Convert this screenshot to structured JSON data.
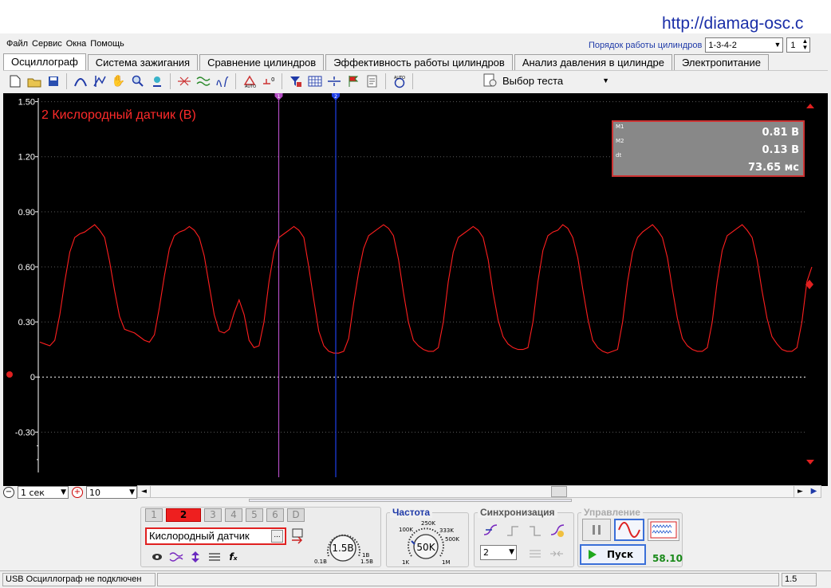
{
  "watermark": "http://diamag-osc.c",
  "menu": [
    "Файл",
    "Сервис",
    "Окна",
    "Помощь"
  ],
  "cylinder_order": {
    "label": "Порядок работы цилиндров",
    "value": "1-3-4-2",
    "number": "1"
  },
  "tabs": [
    {
      "label": "Осциллограф",
      "active": true
    },
    {
      "label": "Система зажигания",
      "active": false
    },
    {
      "label": "Сравнение цилиндров",
      "active": false
    },
    {
      "label": "Эффективность работы цилиндров",
      "active": false
    },
    {
      "label": "Анализ давления в цилиндре",
      "active": false
    },
    {
      "label": "Электропитание",
      "active": false
    }
  ],
  "toolbar": {
    "icons": [
      "new-file-icon",
      "open-folder-icon",
      "save-icon",
      "signal-shape-icon",
      "cursor-measure-icon",
      "hand-pan-icon",
      "zoom-icon",
      "filter-icon",
      "waveform-compare-icon",
      "waveform-multi-icon",
      "waveform-loop-icon",
      "auto-scale-icon",
      "zero-level-icon",
      "trigger-filter-icon",
      "grid-icon",
      "divider-icon",
      "marker-flag-icon",
      "notes-icon",
      "auto-settings-icon"
    ],
    "test_label": "Выбор теста"
  },
  "scope": {
    "channel_title": "2 Кислородный датчик (В)",
    "trace_color": "#ff1f1f",
    "y_ticks": [
      "1.50",
      "1.20",
      "0.90",
      "0.60",
      "0.30",
      "0",
      "-0.30"
    ],
    "y_tick_values": [
      1.5,
      1.2,
      0.9,
      0.6,
      0.3,
      0,
      -0.3
    ],
    "ylim": [
      -0.52,
      1.52
    ],
    "marker1_label": "1",
    "marker2_label": "2",
    "marker1_color": "#b24cc2",
    "marker2_color": "#1f3fe8",
    "waveform": [
      0.19,
      0.18,
      0.17,
      0.2,
      0.34,
      0.52,
      0.68,
      0.76,
      0.78,
      0.79,
      0.81,
      0.83,
      0.8,
      0.76,
      0.63,
      0.47,
      0.33,
      0.26,
      0.25,
      0.24,
      0.22,
      0.2,
      0.19,
      0.23,
      0.38,
      0.55,
      0.7,
      0.77,
      0.79,
      0.8,
      0.82,
      0.8,
      0.76,
      0.66,
      0.5,
      0.34,
      0.25,
      0.24,
      0.26,
      0.35,
      0.42,
      0.34,
      0.2,
      0.16,
      0.17,
      0.3,
      0.52,
      0.68,
      0.76,
      0.78,
      0.8,
      0.82,
      0.8,
      0.76,
      0.6,
      0.42,
      0.25,
      0.17,
      0.14,
      0.13,
      0.13,
      0.14,
      0.21,
      0.4,
      0.57,
      0.7,
      0.77,
      0.79,
      0.81,
      0.83,
      0.81,
      0.77,
      0.64,
      0.46,
      0.3,
      0.2,
      0.17,
      0.15,
      0.14,
      0.14,
      0.16,
      0.3,
      0.52,
      0.68,
      0.76,
      0.78,
      0.8,
      0.82,
      0.8,
      0.76,
      0.64,
      0.46,
      0.31,
      0.22,
      0.18,
      0.16,
      0.15,
      0.15,
      0.16,
      0.3,
      0.52,
      0.69,
      0.77,
      0.79,
      0.8,
      0.83,
      0.81,
      0.76,
      0.65,
      0.48,
      0.32,
      0.2,
      0.16,
      0.14,
      0.13,
      0.14,
      0.15,
      0.3,
      0.52,
      0.68,
      0.76,
      0.79,
      0.81,
      0.83,
      0.8,
      0.76,
      0.65,
      0.48,
      0.32,
      0.21,
      0.17,
      0.15,
      0.14,
      0.14,
      0.16,
      0.3,
      0.52,
      0.69,
      0.77,
      0.79,
      0.81,
      0.83,
      0.8,
      0.76,
      0.64,
      0.47,
      0.32,
      0.22,
      0.18,
      0.15,
      0.14,
      0.14,
      0.16,
      0.3,
      0.52,
      0.6
    ]
  },
  "measurements": {
    "m1_label": "M1",
    "m1_value": "0.81 В",
    "m2_label": "M2",
    "m2_value": "0.13 В",
    "dt_label": "dt",
    "dt_value": "73.65 мс"
  },
  "time_row": {
    "time_per_div": "1 сек",
    "count": "10"
  },
  "channels": {
    "buttons": [
      "1",
      "2",
      "3",
      "4",
      "5",
      "6",
      "D"
    ],
    "active": "2",
    "sensor_name": "Кислородный датчик",
    "sensor_more": "...",
    "range_value": "1.5В",
    "range_min": "0.1В",
    "range_max": "1.5В",
    "range_extra": "1В"
  },
  "frequency": {
    "title": "Частота",
    "value": "50K",
    "ticks": [
      "100K",
      "250K",
      "333K",
      "500K",
      "1M",
      "1K"
    ]
  },
  "sync": {
    "title": "Синхронизация",
    "channel": "2"
  },
  "control": {
    "title": "Управление",
    "start_label": "Пуск",
    "value": "58.10"
  },
  "statusbar": {
    "connection": "USB Осциллограф не подключен",
    "right": "1.5"
  }
}
